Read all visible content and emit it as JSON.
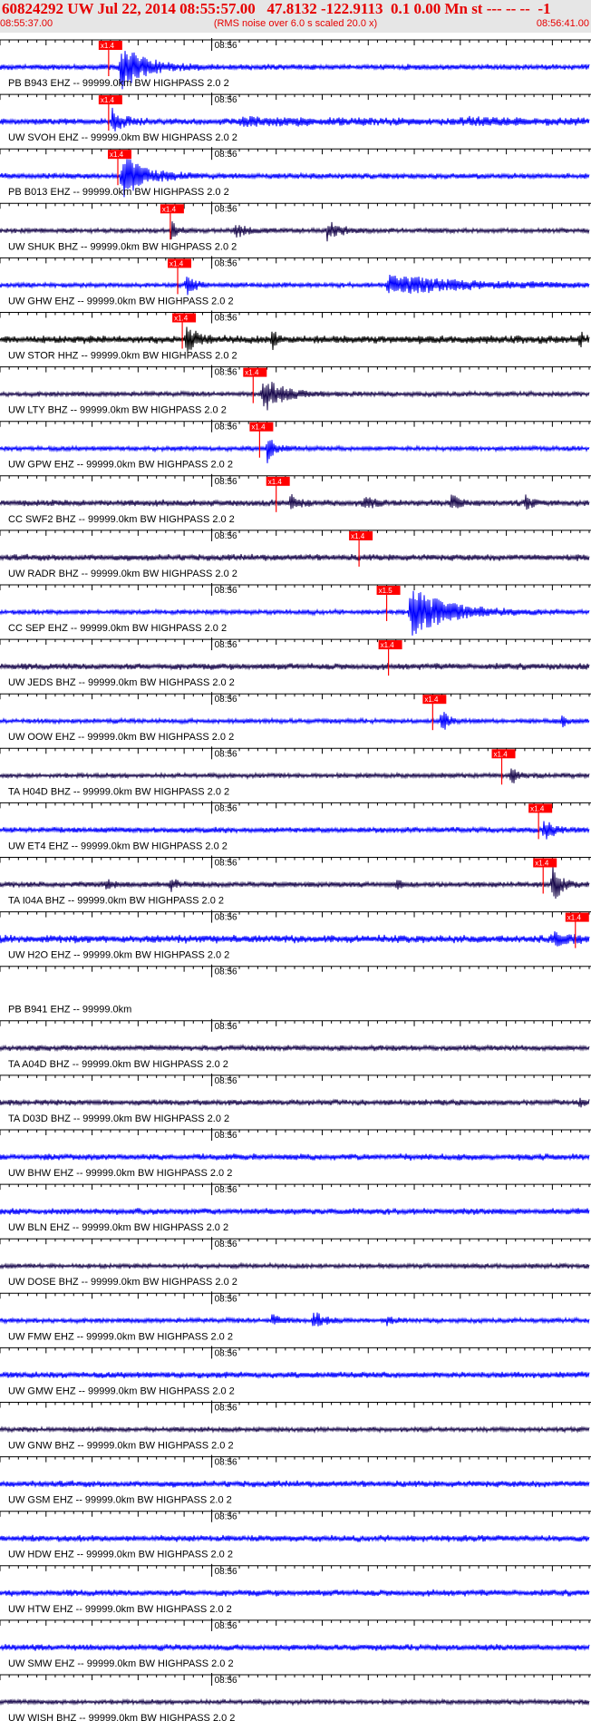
{
  "header": {
    "title": "60824292 UW Jul 22, 2014 08:55:57.00   47.8132 -122.9113  0.1 0.00 Mn st --- -- --  -1",
    "start_time": "08:55:37.00",
    "rms_note": "(RMS noise over 6.0 s scaled 20.0 x)",
    "end_time": "08:56:41.00"
  },
  "colors": {
    "header_text": "#e60000",
    "header_bg": "#e6e6e6",
    "trace_blue": "#0000ff",
    "trace_dark": "#1a0a4d",
    "trace_black": "#000000",
    "pick_marker": "#ff0000",
    "axis": "#000000"
  },
  "chart_data": {
    "type": "line",
    "x_unit": "seconds after 08:55:37.00",
    "xlim": [
      0,
      64
    ],
    "minute_label": "08:56",
    "minute_mark_seconds": 23,
    "traces": [
      {
        "label": "PB B943 EHZ -- 99999.0km BW  HIGHPASS  2.0  2",
        "color": "blue",
        "pick": {
          "label": "x1.4",
          "t": 11.8
        },
        "amp": 3.5,
        "bursts": [
          {
            "t": 13.0,
            "a": 1.0,
            "d": 2.5
          }
        ]
      },
      {
        "label": "UW SVOH EHZ -- 99999.0km BW  HIGHPASS  2.0  2",
        "color": "blue",
        "pick": {
          "label": "x1.4",
          "t": 11.8
        },
        "amp": 4,
        "bursts": [
          {
            "t": 12.2,
            "a": 0.55,
            "d": 1.0
          },
          {
            "t": 26,
            "a": 0.12,
            "d": 12
          },
          {
            "t": 50,
            "a": 0.08,
            "d": 10
          }
        ]
      },
      {
        "label": "PB B013 EHZ -- 99999.0km BW  HIGHPASS  2.0  2",
        "color": "blue",
        "pick": {
          "label": "x1.4",
          "t": 12.8
        },
        "amp": 3.5,
        "bursts": [
          {
            "t": 13.2,
            "a": 0.9,
            "d": 2.4
          }
        ]
      },
      {
        "label": "UW SHUK BHZ -- 99999.0km BW  HIGHPASS  2.0  2",
        "color": "dark",
        "pick": {
          "label": "x1.4",
          "t": 18.5
        },
        "amp": 3,
        "bursts": [
          {
            "t": 18.6,
            "a": 0.5,
            "d": 0.6
          },
          {
            "t": 25.5,
            "a": 0.25,
            "d": 1.5
          },
          {
            "t": 35.5,
            "a": 0.45,
            "d": 1.2
          }
        ]
      },
      {
        "label": "UW GHW EHZ -- 99999.0km BW  HIGHPASS  2.0  2",
        "color": "blue",
        "pick": {
          "label": "x1.4",
          "t": 19.3
        },
        "amp": 3,
        "bursts": [
          {
            "t": 20.2,
            "a": 0.5,
            "d": 0.8
          },
          {
            "t": 42,
            "a": 0.4,
            "d": 8
          }
        ]
      },
      {
        "label": "UW STOR HHZ -- 99999.0km BW  HIGHPASS  2.0  2",
        "color": "black",
        "pick": {
          "label": "x1.4",
          "t": 19.8
        },
        "amp": 5,
        "bursts": [
          {
            "t": 20.2,
            "a": 0.6,
            "d": 1.0
          },
          {
            "t": 29.5,
            "a": 0.45,
            "d": 0.5
          },
          {
            "t": 63,
            "a": 0.3,
            "d": 0.4
          }
        ]
      },
      {
        "label": "UW LTY BHZ -- 99999.0km BW  HIGHPASS  2.0  2",
        "color": "dark",
        "pick": {
          "label": "x1.4",
          "t": 27.5
        },
        "amp": 3,
        "bursts": [
          {
            "t": 28.5,
            "a": 0.8,
            "d": 2.0
          }
        ]
      },
      {
        "label": "UW GPW EHZ -- 99999.0km BW  HIGHPASS  2.0  2",
        "color": "blue",
        "pick": {
          "label": "x1.4",
          "t": 28.2
        },
        "amp": 3,
        "bursts": [
          {
            "t": 29.0,
            "a": 0.6,
            "d": 0.8
          }
        ]
      },
      {
        "label": "CC SWF2 BHZ -- 99999.0km BW  HIGHPASS  2.0  2",
        "color": "dark",
        "pick": {
          "label": "x1.4",
          "t": 30.0
        },
        "amp": 4,
        "bursts": [
          {
            "t": 31.5,
            "a": 0.35,
            "d": 0.8
          },
          {
            "t": 39.5,
            "a": 0.3,
            "d": 0.8
          },
          {
            "t": 49,
            "a": 0.35,
            "d": 0.8
          },
          {
            "t": 57,
            "a": 0.3,
            "d": 0.6
          }
        ]
      },
      {
        "label": "UW RADR BHZ -- 99999.0km BW  HIGHPASS  2.0  2",
        "color": "dark",
        "pick": {
          "label": "x1.4",
          "t": 39.0
        },
        "amp": 4,
        "bursts": []
      },
      {
        "label": "CC SEP EHZ -- 99999.0km BW  HIGHPASS  2.0  2",
        "color": "blue",
        "pick": {
          "label": "x1.5",
          "t": 42.0
        },
        "amp": 3,
        "bursts": [
          {
            "t": 44.5,
            "a": 1.0,
            "d": 4.0
          }
        ]
      },
      {
        "label": "UW JEDS BHZ -- 99999.0km BW  HIGHPASS  2.0  2",
        "color": "dark",
        "pick": {
          "label": "x1.4",
          "t": 42.2
        },
        "amp": 4,
        "bursts": []
      },
      {
        "label": "UW OOW EHZ -- 99999.0km BW  HIGHPASS  2.0  2",
        "color": "blue",
        "pick": {
          "label": "x1.4",
          "t": 47.0
        },
        "amp": 3,
        "bursts": [
          {
            "t": 48.0,
            "a": 0.6,
            "d": 0.5
          },
          {
            "t": 61,
            "a": 0.3,
            "d": 0.4
          }
        ]
      },
      {
        "label": "TA H04D BHZ -- 99999.0km BW  HIGHPASS  2.0  2",
        "color": "dark",
        "pick": {
          "label": "x1.4",
          "t": 54.5
        },
        "amp": 3,
        "bursts": [
          {
            "t": 55.5,
            "a": 0.4,
            "d": 0.6
          }
        ]
      },
      {
        "label": "UW ET4 EHZ -- 99999.0km BW  HIGHPASS  2.0  2",
        "color": "blue",
        "pick": {
          "label": "x1.4",
          "t": 58.5
        },
        "amp": 3.5,
        "bursts": [
          {
            "t": 59.0,
            "a": 0.45,
            "d": 1.0
          }
        ]
      },
      {
        "label": "TA I04A BHZ -- 99999.0km BW  HIGHPASS  2.0  2",
        "color": "dark",
        "pick": {
          "label": "x1.4",
          "t": 59.0
        },
        "amp": 3.5,
        "bursts": [
          {
            "t": 11.5,
            "a": 0.3,
            "d": 0.5
          },
          {
            "t": 18.5,
            "a": 0.35,
            "d": 0.5
          },
          {
            "t": 43,
            "a": 0.25,
            "d": 0.5
          },
          {
            "t": 60.0,
            "a": 0.9,
            "d": 0.8
          }
        ]
      },
      {
        "label": "UW H2O EHZ -- 99999.0km BW  HIGHPASS  2.0  2",
        "color": "blue",
        "pick": {
          "label": "x1.4",
          "t": 62.5
        },
        "amp": 5,
        "bursts": [
          {
            "t": 60,
            "a": 0.2,
            "d": 2.5
          }
        ]
      },
      {
        "label": "PB B941 EHZ -- 99999.0km",
        "color": "blue",
        "pick": null,
        "amp": 0,
        "bursts": []
      },
      {
        "label": "TA A04D BHZ -- 99999.0km BW  HIGHPASS  2.0  2",
        "color": "dark",
        "pick": null,
        "amp": 3.5,
        "bursts": []
      },
      {
        "label": "TA D03D BHZ -- 99999.0km BW  HIGHPASS  2.0  2",
        "color": "dark",
        "pick": null,
        "amp": 3.5,
        "bursts": [
          {
            "t": 63,
            "a": 0.15,
            "d": 1
          }
        ]
      },
      {
        "label": "UW BHW EHZ -- 99999.0km BW  HIGHPASS  2.0  2",
        "color": "blue",
        "pick": null,
        "amp": 4,
        "bursts": []
      },
      {
        "label": "UW BLN EHZ -- 99999.0km BW  HIGHPASS  2.0  2",
        "color": "blue",
        "pick": null,
        "amp": 4,
        "bursts": []
      },
      {
        "label": "UW DOSE BHZ -- 99999.0km BW  HIGHPASS  2.0  2",
        "color": "dark",
        "pick": null,
        "amp": 3,
        "bursts": []
      },
      {
        "label": "UW FMW EHZ -- 99999.0km BW  HIGHPASS  2.0  2",
        "color": "blue",
        "pick": null,
        "amp": 3,
        "bursts": [
          {
            "t": 29.5,
            "a": 0.3,
            "d": 0.8
          },
          {
            "t": 34,
            "a": 0.45,
            "d": 1.0
          },
          {
            "t": 42,
            "a": 0.2,
            "d": 0.6
          }
        ]
      },
      {
        "label": "UW GMW EHZ -- 99999.0km BW  HIGHPASS  2.0  2",
        "color": "blue",
        "pick": null,
        "amp": 4,
        "bursts": []
      },
      {
        "label": "UW GNW BHZ -- 99999.0km BW  HIGHPASS  2.0  2",
        "color": "dark",
        "pick": null,
        "amp": 3,
        "bursts": []
      },
      {
        "label": "UW GSM EHZ -- 99999.0km BW  HIGHPASS  2.0  2",
        "color": "blue",
        "pick": null,
        "amp": 4,
        "bursts": []
      },
      {
        "label": "UW HDW EHZ -- 99999.0km BW  HIGHPASS  2.0  2",
        "color": "blue",
        "pick": null,
        "amp": 4,
        "bursts": []
      },
      {
        "label": "UW HTW EHZ -- 99999.0km BW  HIGHPASS  2.0  2",
        "color": "blue",
        "pick": null,
        "amp": 4,
        "bursts": []
      },
      {
        "label": "UW SMW EHZ -- 99999.0km BW  HIGHPASS  2.0  2",
        "color": "blue",
        "pick": null,
        "amp": 4,
        "bursts": []
      },
      {
        "label": "UW WISH BHZ -- 99999.0km BW  HIGHPASS  2.0  2",
        "color": "dark",
        "pick": null,
        "amp": 3,
        "bursts": []
      }
    ]
  }
}
